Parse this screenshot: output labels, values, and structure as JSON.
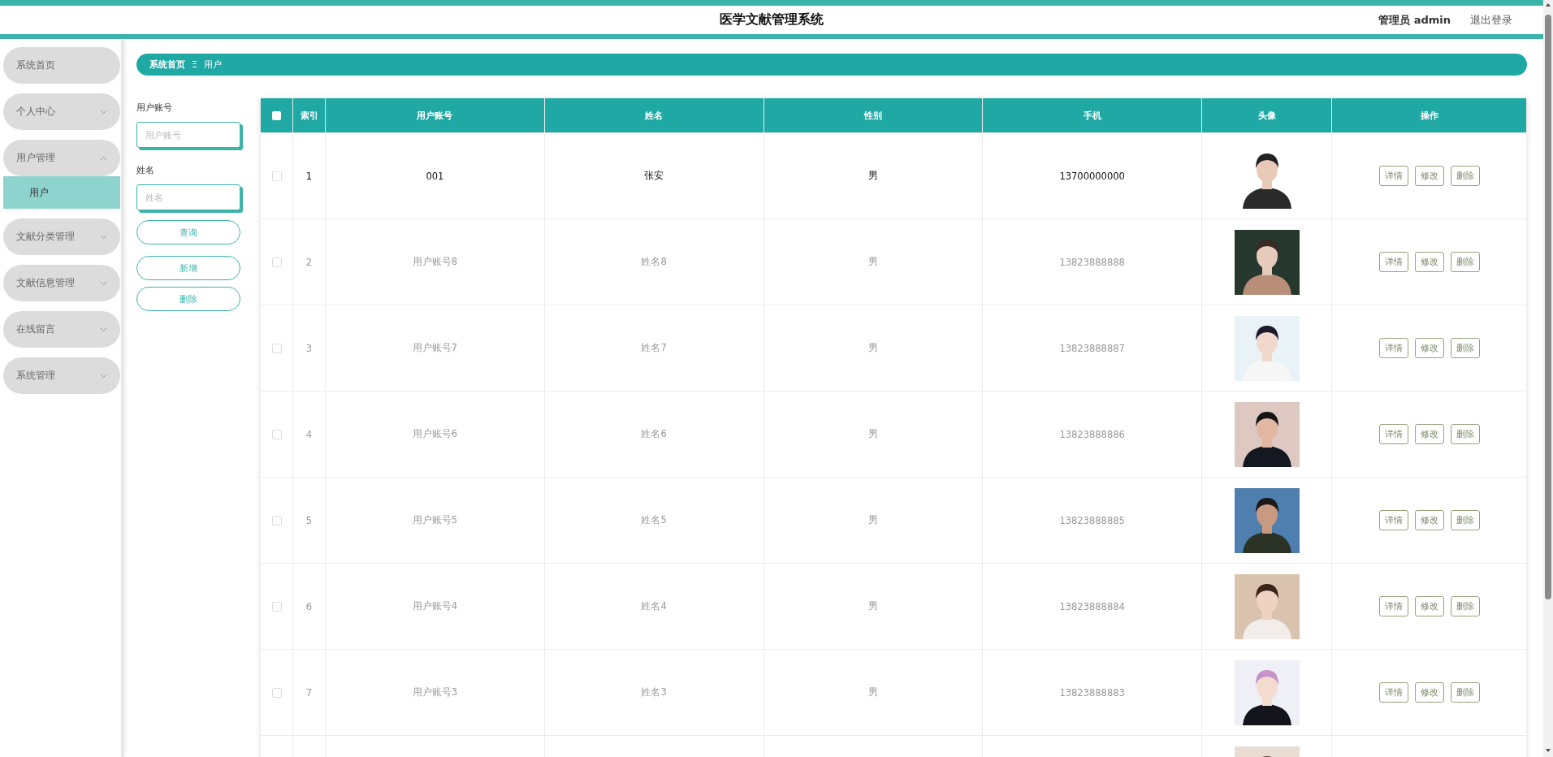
{
  "header": {
    "title": "医学文献管理系统",
    "user": "管理员 admin",
    "logout": "退出登录"
  },
  "sidebar": {
    "items": [
      {
        "label": "系统首页"
      },
      {
        "label": "个人中心",
        "expanded": false
      },
      {
        "label": "用户管理",
        "expanded": true,
        "children": [
          {
            "label": "用户",
            "selected": true
          }
        ]
      },
      {
        "label": "文献分类管理",
        "expanded": false
      },
      {
        "label": "文献信息管理",
        "expanded": false
      },
      {
        "label": "在线留言",
        "expanded": false
      },
      {
        "label": "系统管理",
        "expanded": false
      }
    ]
  },
  "breadcrumb": {
    "home": "系统首页",
    "separator": "Ξ",
    "current": "用户"
  },
  "search": {
    "fields": [
      {
        "label": "用户账号",
        "placeholder": "用户账号"
      },
      {
        "label": "姓名",
        "placeholder": "姓名"
      }
    ],
    "buttons": [
      "查询",
      "新增",
      "删除"
    ]
  },
  "table": {
    "select_all_checked": false,
    "columns": [
      "索引",
      "用户账号",
      "姓名",
      "性别",
      "手机",
      "头像",
      "操作"
    ],
    "rows": [
      {
        "checked": false,
        "highlighted": true,
        "index": "1",
        "account": "001",
        "name": "张安",
        "gender": "男",
        "phone": "13700000000",
        "avatar": {
          "kind": "picture"
        },
        "actions": [
          "详情",
          "修改",
          "删除"
        ]
      },
      {
        "checked": false,
        "highlighted": false,
        "index": "2",
        "account": "用户账号8",
        "name": "姓名8",
        "gender": "男",
        "phone": "13823888888",
        "avatar": {
          "kind": "picture"
        },
        "actions": [
          "详情",
          "修改",
          "删除"
        ]
      },
      {
        "checked": false,
        "highlighted": false,
        "index": "3",
        "account": "用户账号7",
        "name": "姓名7",
        "gender": "男",
        "phone": "13823888887",
        "avatar": {
          "kind": "picture"
        },
        "actions": [
          "详情",
          "修改",
          "删除"
        ]
      },
      {
        "checked": false,
        "highlighted": false,
        "index": "4",
        "account": "用户账号6",
        "name": "姓名6",
        "gender": "男",
        "phone": "13823888886",
        "avatar": {
          "kind": "picture"
        },
        "actions": [
          "详情",
          "修改",
          "删除"
        ]
      },
      {
        "checked": false,
        "highlighted": false,
        "index": "5",
        "account": "用户账号5",
        "name": "姓名5",
        "gender": "男",
        "phone": "13823888885",
        "avatar": {
          "kind": "picture"
        },
        "actions": [
          "详情",
          "修改",
          "删除"
        ]
      },
      {
        "checked": false,
        "highlighted": false,
        "index": "6",
        "account": "用户账号4",
        "name": "姓名4",
        "gender": "男",
        "phone": "13823888884",
        "avatar": {
          "kind": "picture"
        },
        "actions": [
          "详情",
          "修改",
          "删除"
        ]
      },
      {
        "checked": false,
        "highlighted": false,
        "index": "7",
        "account": "用户账号3",
        "name": "姓名3",
        "gender": "男",
        "phone": "13823888883",
        "avatar": {
          "kind": "picture"
        },
        "actions": [
          "详情",
          "修改",
          "删除"
        ]
      },
      {
        "avatar": {
          "kind": "picture"
        }
      }
    ]
  }
}
